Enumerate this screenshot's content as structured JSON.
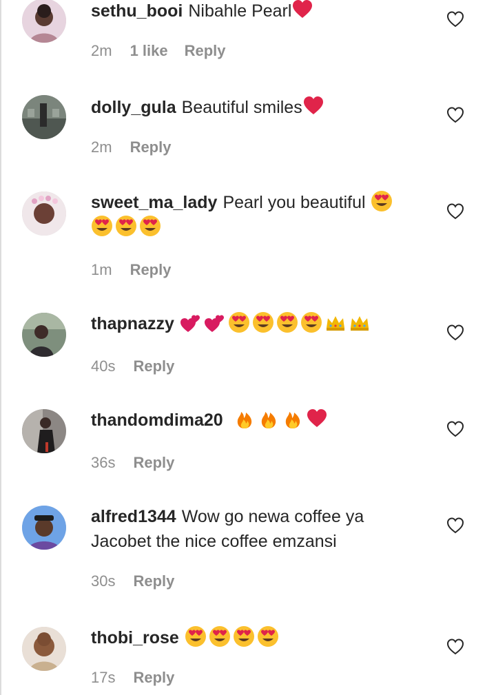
{
  "comments": [
    {
      "username": "sethu_booi",
      "text": "Nibahle Pearl",
      "emojis": [
        "red-heart"
      ],
      "time": "2m",
      "likes": "1 like",
      "reply": "Reply",
      "avatar": "avatar-sethu-booi",
      "avatar_color": "#c89aa8"
    },
    {
      "username": "dolly_gula",
      "text": "Beautiful smiles",
      "emojis": [
        "red-heart"
      ],
      "time": "2m",
      "likes": "",
      "reply": "Reply",
      "avatar": "avatar-dolly-gula",
      "avatar_color": "#6f7b70"
    },
    {
      "username": "sweet_ma_lady",
      "text": "Pearl you beautiful",
      "emojis": [
        "heart-eyes",
        "heart-eyes",
        "heart-eyes",
        "heart-eyes"
      ],
      "time": "1m",
      "likes": "",
      "reply": "Reply",
      "avatar": "avatar-sweet-ma-lady",
      "avatar_color": "#b7868e"
    },
    {
      "username": "thapnazzy",
      "text": "",
      "emojis": [
        "two-hearts",
        "two-hearts",
        "heart-eyes",
        "heart-eyes",
        "heart-eyes",
        "heart-eyes",
        "crown",
        "crown"
      ],
      "time": "40s",
      "likes": "",
      "reply": "Reply",
      "avatar": "avatar-thapnazzy",
      "avatar_color": "#6d7f6d"
    },
    {
      "username": "thandomdima20",
      "text": "",
      "emojis": [
        "fire",
        "fire",
        "fire",
        "red-heart"
      ],
      "time": "36s",
      "likes": "",
      "reply": "Reply",
      "avatar": "avatar-thandomdima20",
      "avatar_color": "#7d7a78"
    },
    {
      "username": "alfred1344",
      "text": "Wow go newa coffee ya Jacobet the nice coffee emzansi",
      "emojis": [],
      "time": "30s",
      "likes": "",
      "reply": "Reply",
      "avatar": "avatar-alfred1344",
      "avatar_color": "#5d8bd1"
    },
    {
      "username": "thobi_rose",
      "text": "",
      "emojis": [
        "heart-eyes",
        "heart-eyes",
        "heart-eyes",
        "heart-eyes"
      ],
      "time": "17s",
      "likes": "",
      "reply": "Reply",
      "avatar": "avatar-thobi-rose",
      "avatar_color": "#a77654"
    }
  ],
  "colors": {
    "text": "#262626",
    "muted": "#8e8e8e",
    "heart_red": "#e0244a"
  }
}
